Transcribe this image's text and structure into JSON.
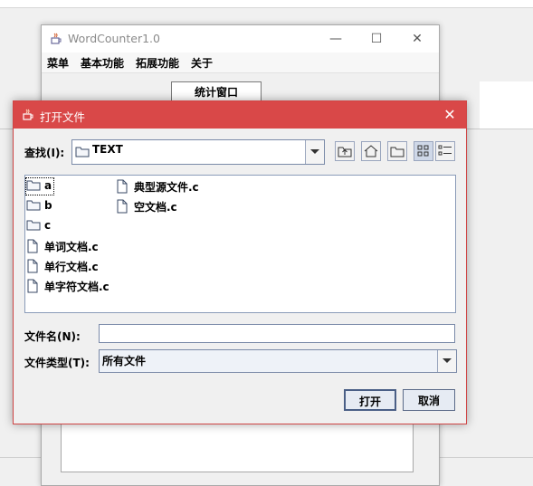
{
  "main_window": {
    "title": "WordCounter1.0",
    "menus": [
      "菜单",
      "基本功能",
      "拓展功能",
      "关于"
    ],
    "stat_button": "统计窗口",
    "controls": {
      "minimize": "—",
      "maximize": "☐",
      "close": "✕"
    }
  },
  "dialog": {
    "title": "打开文件",
    "close": "✕",
    "look_in_label": "查找(I):",
    "look_in_value": "TEXT",
    "toolbar_icons": [
      "up-folder-icon",
      "home-icon",
      "new-folder-icon",
      "list-view-icon",
      "details-view-icon"
    ],
    "files": [
      {
        "name": "a",
        "type": "folder"
      },
      {
        "name": "b",
        "type": "folder"
      },
      {
        "name": "c",
        "type": "folder"
      },
      {
        "name": "单词文档.c",
        "type": "file"
      },
      {
        "name": "单行文档.c",
        "type": "file"
      },
      {
        "name": "单字符文档.c",
        "type": "file"
      },
      {
        "name": "典型源文件.c",
        "type": "file"
      },
      {
        "name": "空文档.c",
        "type": "file"
      }
    ],
    "filename_label": "文件名(N):",
    "filename_value": "",
    "filetype_label": "文件类型(T):",
    "filetype_value": "所有文件",
    "open_button": "打开",
    "cancel_button": "取消"
  }
}
